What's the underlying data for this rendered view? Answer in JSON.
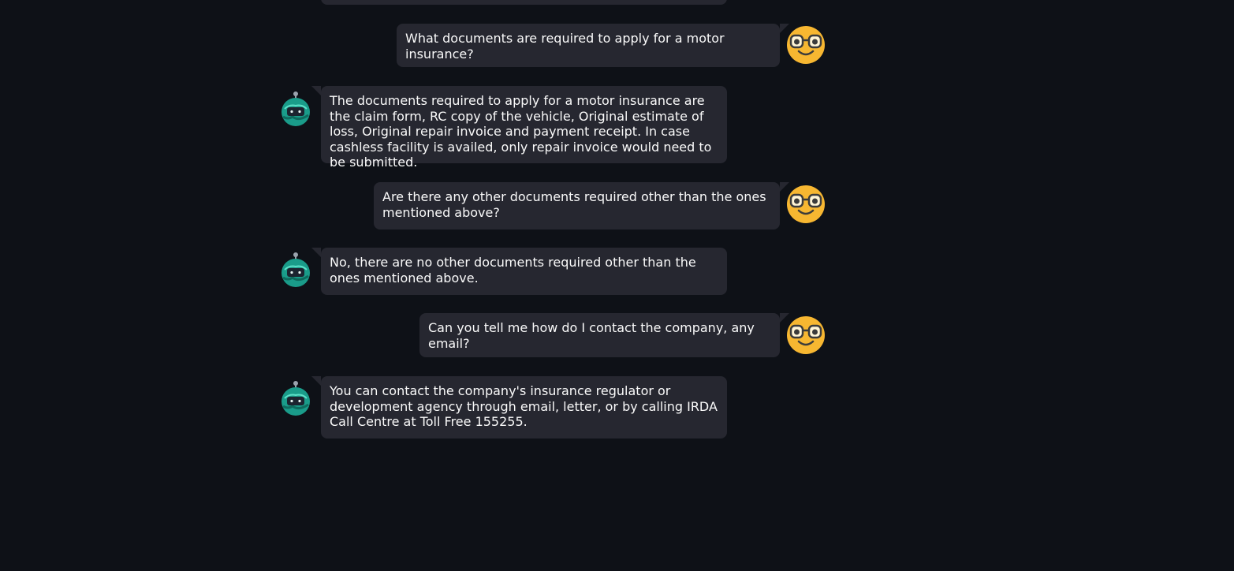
{
  "messages": [
    {
      "role": "user",
      "text": "What documents are required to apply for a motor insurance?",
      "avatar": "nerd-face-icon"
    },
    {
      "role": "assistant",
      "text": "The documents required to apply for a motor insurance are the claim form, RC copy of the vehicle, Original estimate of loss, Original repair invoice and payment receipt. In case cashless facility is availed, only repair invoice would need to be submitted.",
      "avatar": "robot-icon"
    },
    {
      "role": "user",
      "text": "Are there any other documents required other than the ones mentioned above?",
      "avatar": "nerd-face-icon"
    },
    {
      "role": "assistant",
      "text": "No, there are no other documents required other than the ones mentioned above.",
      "avatar": "robot-icon"
    },
    {
      "role": "user",
      "text": "Can you tell me how do I contact the company, any email?",
      "avatar": "nerd-face-icon"
    },
    {
      "role": "assistant",
      "text": "You can contact the company's insurance regulator or development agency through email, letter, or by calling IRDA Call Centre at Toll Free 155255.",
      "avatar": "robot-icon"
    }
  ],
  "colors": {
    "background": "#0e1117",
    "bubble": "#262730",
    "text": "#fafafa",
    "user_avatar": "#f7b731",
    "bot_avatar": "#1a9c8a"
  }
}
